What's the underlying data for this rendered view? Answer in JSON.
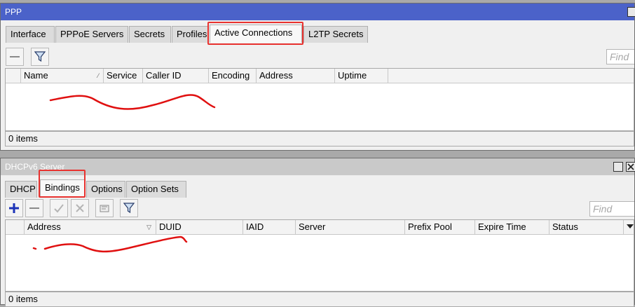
{
  "ppp": {
    "title": "PPP",
    "tabs": [
      "Interface",
      "PPPoE Servers",
      "Secrets",
      "Profiles",
      "Active Connections",
      "L2TP Secrets"
    ],
    "active_tab": "Active Connections",
    "find_placeholder": "Find",
    "columns": [
      "Name",
      "Service",
      "Caller ID",
      "Encoding",
      "Address",
      "Uptime"
    ],
    "status": "0 items"
  },
  "dhcp": {
    "title": "DHCPv6 Server",
    "tabs": [
      "DHCP",
      "Bindings",
      "Options",
      "Option Sets"
    ],
    "active_tab": "Bindings",
    "find_placeholder": "Find",
    "columns": [
      "Address",
      "DUID",
      "IAID",
      "Server",
      "Prefix Pool",
      "Expire Time",
      "Status"
    ],
    "status": "0 items"
  },
  "colors": {
    "highlight": "#e8322f",
    "titlebar_active": "#4b62c9",
    "add_icon": "#1c33b8"
  },
  "icons": [
    "remove-icon",
    "filter-icon",
    "add-icon",
    "check-icon",
    "cross-icon",
    "comment-icon",
    "filter-icon",
    "dropdown-icon"
  ]
}
